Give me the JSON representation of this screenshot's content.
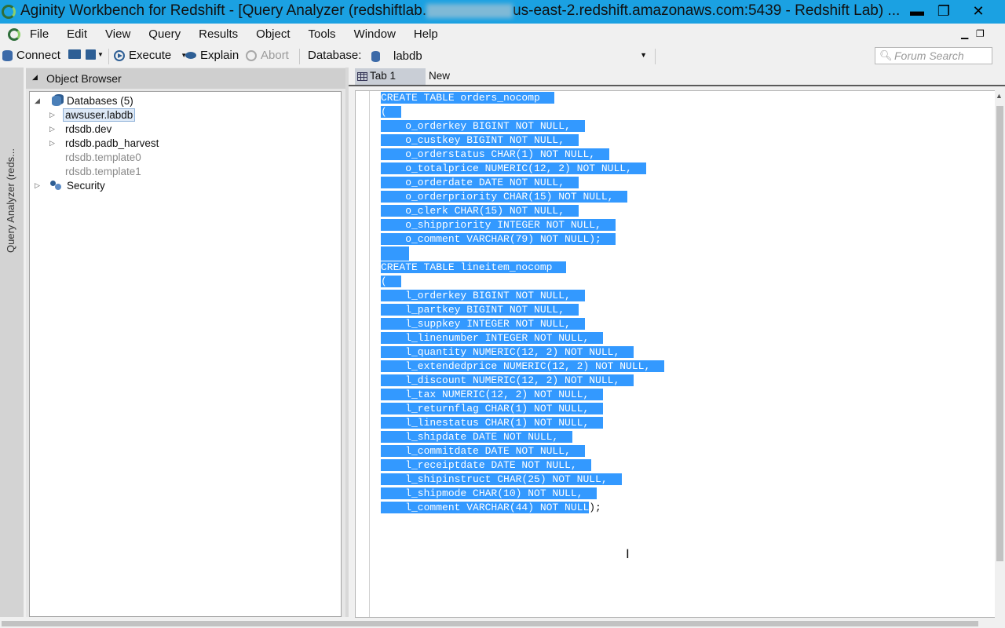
{
  "window": {
    "title_prefix": "Aginity Workbench for Redshift - [Query Analyzer (redshiftlab.",
    "title_suffix": "us-east-2.redshift.amazonaws.com:5439 - Redshift Lab) ...",
    "minimize": "▬",
    "restore": "❐",
    "close": "✕"
  },
  "menubar": {
    "items": [
      "File",
      "Edit",
      "View",
      "Query",
      "Results",
      "Object",
      "Tools",
      "Window",
      "Help"
    ],
    "mdi_minimize": "▁",
    "mdi_restore": "❐"
  },
  "toolbar": {
    "connect": "Connect",
    "execute": "Execute",
    "explain": "Explain",
    "abort": "Abort",
    "database_label": "Database:",
    "database_value": "labdb",
    "search_placeholder": "Forum Search"
  },
  "side_tab": {
    "label": "Query Analyzer (reds..."
  },
  "object_browser": {
    "title": "Object Browser",
    "tree": {
      "databases": "Databases (5)",
      "db1": "awsuser.labdb",
      "db2": "rdsdb.dev",
      "db3": "rdsdb.padb_harvest",
      "db4": "rdsdb.template0",
      "db5": "rdsdb.template1",
      "security": "Security"
    }
  },
  "tabs": {
    "tab1": "Tab 1",
    "new": "New"
  },
  "editor": {
    "lines": [
      "CREATE TABLE orders_nocomp",
      "(",
      "    o_orderkey BIGINT NOT NULL,",
      "    o_custkey BIGINT NOT NULL,",
      "    o_orderstatus CHAR(1) NOT NULL,",
      "    o_totalprice NUMERIC(12, 2) NOT NULL,",
      "    o_orderdate DATE NOT NULL,",
      "    o_orderpriority CHAR(15) NOT NULL,",
      "    o_clerk CHAR(15) NOT NULL,",
      "    o_shippriority INTEGER NOT NULL,",
      "    o_comment VARCHAR(79) NOT NULL);",
      "",
      "CREATE TABLE lineitem_nocomp",
      "(",
      "    l_orderkey BIGINT NOT NULL,",
      "    l_partkey BIGINT NOT NULL,",
      "    l_suppkey INTEGER NOT NULL,",
      "    l_linenumber INTEGER NOT NULL,",
      "    l_quantity NUMERIC(12, 2) NOT NULL,",
      "    l_extendedprice NUMERIC(12, 2) NOT NULL,",
      "    l_discount NUMERIC(12, 2) NOT NULL,",
      "    l_tax NUMERIC(12, 2) NOT NULL,",
      "    l_returnflag CHAR(1) NOT NULL,",
      "    l_linestatus CHAR(1) NOT NULL,",
      "    l_shipdate DATE NOT NULL,",
      "    l_commitdate DATE NOT NULL,",
      "    l_receiptdate DATE NOT NULL,",
      "    l_shipinstruct CHAR(25) NOT NULL,",
      "    l_shipmode CHAR(10) NOT NULL,",
      "    l_comment VARCHAR(44) NOT NULL"
    ],
    "last_line_tail": ");",
    "selection_color": "#3399ff"
  }
}
